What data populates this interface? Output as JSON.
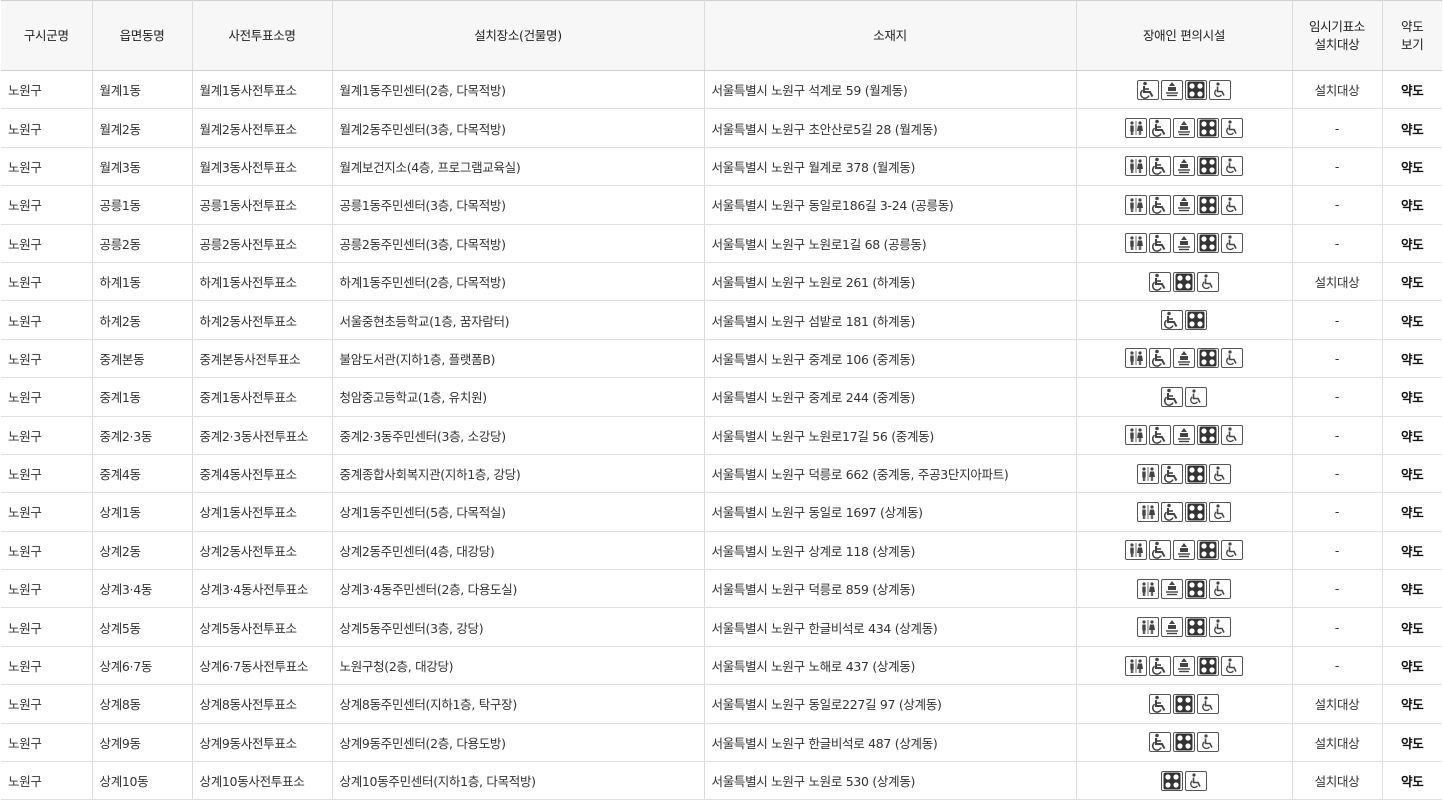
{
  "headers": {
    "gu": "구시군명",
    "dong": "읍면동명",
    "station": "사전투표소명",
    "place": "설치장소(건물명)",
    "address": "소재지",
    "facilities": "장애인 편의시설",
    "temp_line1": "임시기표소",
    "temp_line2": "설치대상",
    "map_line1": "약도",
    "map_line2": "보기"
  },
  "rows": [
    {
      "gu": "노원구",
      "dong": "월계1동",
      "station": "월계1동사전투표소",
      "place": "월계1동주민센터(2층, 다목적방)",
      "address": "서울특별시 노원구 석계로 59 (월계동)",
      "icons": [
        "wheelchair-icon",
        "elevator-icon",
        "braille-icon",
        "access-icon"
      ],
      "temp": "설치대상",
      "map": "약도"
    },
    {
      "gu": "노원구",
      "dong": "월계2동",
      "station": "월계2동사전투표소",
      "place": "월계2동주민센터(3층, 다목적방)",
      "address": "서울특별시 노원구 초안산로5길 28 (월계동)",
      "icons": [
        "restroom-icon",
        "wheelchair-icon",
        "elevator-icon",
        "braille-icon",
        "access-icon"
      ],
      "temp": "-",
      "map": "약도"
    },
    {
      "gu": "노원구",
      "dong": "월계3동",
      "station": "월계3동사전투표소",
      "place": "월계보건지소(4층, 프로그램교육실)",
      "address": "서울특별시 노원구 월계로 378 (월계동)",
      "icons": [
        "restroom-icon",
        "wheelchair-icon",
        "elevator-icon",
        "braille-icon",
        "access-icon"
      ],
      "temp": "-",
      "map": "약도"
    },
    {
      "gu": "노원구",
      "dong": "공릉1동",
      "station": "공릉1동사전투표소",
      "place": "공릉1동주민센터(3층, 다목적방)",
      "address": "서울특별시 노원구 동일로186길 3-24 (공릉동)",
      "icons": [
        "restroom-icon",
        "wheelchair-icon",
        "elevator-icon",
        "braille-icon",
        "access-icon"
      ],
      "temp": "-",
      "map": "약도"
    },
    {
      "gu": "노원구",
      "dong": "공릉2동",
      "station": "공릉2동사전투표소",
      "place": "공릉2동주민센터(3층, 다목적방)",
      "address": "서울특별시 노원구 노원로1길 68 (공릉동)",
      "icons": [
        "restroom-icon",
        "wheelchair-icon",
        "elevator-icon",
        "braille-icon",
        "access-icon"
      ],
      "temp": "-",
      "map": "약도"
    },
    {
      "gu": "노원구",
      "dong": "하계1동",
      "station": "하계1동사전투표소",
      "place": "하계1동주민센터(2층, 다목적방)",
      "address": "서울특별시 노원구 노원로 261 (하계동)",
      "icons": [
        "wheelchair-icon",
        "braille-icon",
        "access-icon"
      ],
      "temp": "설치대상",
      "map": "약도"
    },
    {
      "gu": "노원구",
      "dong": "하계2동",
      "station": "하계2동사전투표소",
      "place": "서울중현초등학교(1층, 꿈자람터)",
      "address": "서울특별시 노원구 섬밭로 181 (하계동)",
      "icons": [
        "wheelchair-icon",
        "braille-icon"
      ],
      "temp": "-",
      "map": "약도"
    },
    {
      "gu": "노원구",
      "dong": "중계본동",
      "station": "중계본동사전투표소",
      "place": "불암도서관(지하1층, 플랫폼B)",
      "address": "서울특별시 노원구 중계로 106 (중계동)",
      "icons": [
        "restroom-icon",
        "wheelchair-icon",
        "elevator-icon",
        "braille-icon",
        "access-icon"
      ],
      "temp": "-",
      "map": "약도"
    },
    {
      "gu": "노원구",
      "dong": "중계1동",
      "station": "중계1동사전투표소",
      "place": "청암중고등학교(1층, 유치원)",
      "address": "서울특별시 노원구 중계로 244 (중계동)",
      "icons": [
        "wheelchair-icon",
        "access-icon"
      ],
      "temp": "-",
      "map": "약도"
    },
    {
      "gu": "노원구",
      "dong": "중계2·3동",
      "station": "중계2·3동사전투표소",
      "place": "중계2·3동주민센터(3층, 소강당)",
      "address": "서울특별시 노원구 노원로17길 56 (중계동)",
      "icons": [
        "restroom-icon",
        "wheelchair-icon",
        "elevator-icon",
        "braille-icon",
        "access-icon"
      ],
      "temp": "-",
      "map": "약도"
    },
    {
      "gu": "노원구",
      "dong": "중계4동",
      "station": "중계4동사전투표소",
      "place": "중계종합사회복지관(지하1층, 강당)",
      "address": "서울특별시 노원구 덕릉로 662 (중계동, 주공3단지아파트)",
      "icons": [
        "restroom-icon",
        "wheelchair-icon",
        "braille-icon",
        "access-icon"
      ],
      "temp": "-",
      "map": "약도"
    },
    {
      "gu": "노원구",
      "dong": "상계1동",
      "station": "상계1동사전투표소",
      "place": "상계1동주민센터(5층, 다목적실)",
      "address": "서울특별시 노원구 동일로 1697 (상계동)",
      "icons": [
        "restroom-icon",
        "wheelchair-icon",
        "braille-icon",
        "access-icon"
      ],
      "temp": "-",
      "map": "약도"
    },
    {
      "gu": "노원구",
      "dong": "상계2동",
      "station": "상계2동사전투표소",
      "place": "상계2동주민센터(4층, 대강당)",
      "address": "서울특별시 노원구 상계로 118 (상계동)",
      "icons": [
        "restroom-icon",
        "wheelchair-icon",
        "elevator-icon",
        "braille-icon",
        "access-icon"
      ],
      "temp": "-",
      "map": "약도"
    },
    {
      "gu": "노원구",
      "dong": "상계3·4동",
      "station": "상계3·4동사전투표소",
      "place": "상계3·4동주민센터(2층, 다용도실)",
      "address": "서울특별시 노원구 덕릉로 859 (상계동)",
      "icons": [
        "restroom-icon",
        "elevator-icon",
        "braille-icon",
        "access-icon"
      ],
      "temp": "-",
      "map": "약도"
    },
    {
      "gu": "노원구",
      "dong": "상계5동",
      "station": "상계5동사전투표소",
      "place": "상계5동주민센터(3층, 강당)",
      "address": "서울특별시 노원구 한글비석로 434 (상계동)",
      "icons": [
        "restroom-icon",
        "elevator-icon",
        "braille-icon",
        "access-icon"
      ],
      "temp": "-",
      "map": "약도"
    },
    {
      "gu": "노원구",
      "dong": "상계6·7동",
      "station": "상계6·7동사전투표소",
      "place": "노원구청(2층, 대강당)",
      "address": "서울특별시 노원구 노해로 437 (상계동)",
      "icons": [
        "restroom-icon",
        "wheelchair-icon",
        "elevator-icon",
        "braille-icon",
        "access-icon"
      ],
      "temp": "-",
      "map": "약도"
    },
    {
      "gu": "노원구",
      "dong": "상계8동",
      "station": "상계8동사전투표소",
      "place": "상계8동주민센터(지하1층, 탁구장)",
      "address": "서울특별시 노원구 동일로227길 97 (상계동)",
      "icons": [
        "wheelchair-icon",
        "braille-icon",
        "access-icon"
      ],
      "temp": "설치대상",
      "map": "약도"
    },
    {
      "gu": "노원구",
      "dong": "상계9동",
      "station": "상계9동사전투표소",
      "place": "상계9동주민센터(2층, 다용도방)",
      "address": "서울특별시 노원구 한글비석로 487 (상계동)",
      "icons": [
        "wheelchair-icon",
        "braille-icon",
        "access-icon"
      ],
      "temp": "설치대상",
      "map": "약도"
    },
    {
      "gu": "노원구",
      "dong": "상계10동",
      "station": "상계10동사전투표소",
      "place": "상계10동주민센터(지하1층, 다목적방)",
      "address": "서울특별시 노원구 노원로 530 (상계동)",
      "icons": [
        "braille-icon",
        "access-icon"
      ],
      "temp": "설치대상",
      "map": "약도"
    }
  ]
}
